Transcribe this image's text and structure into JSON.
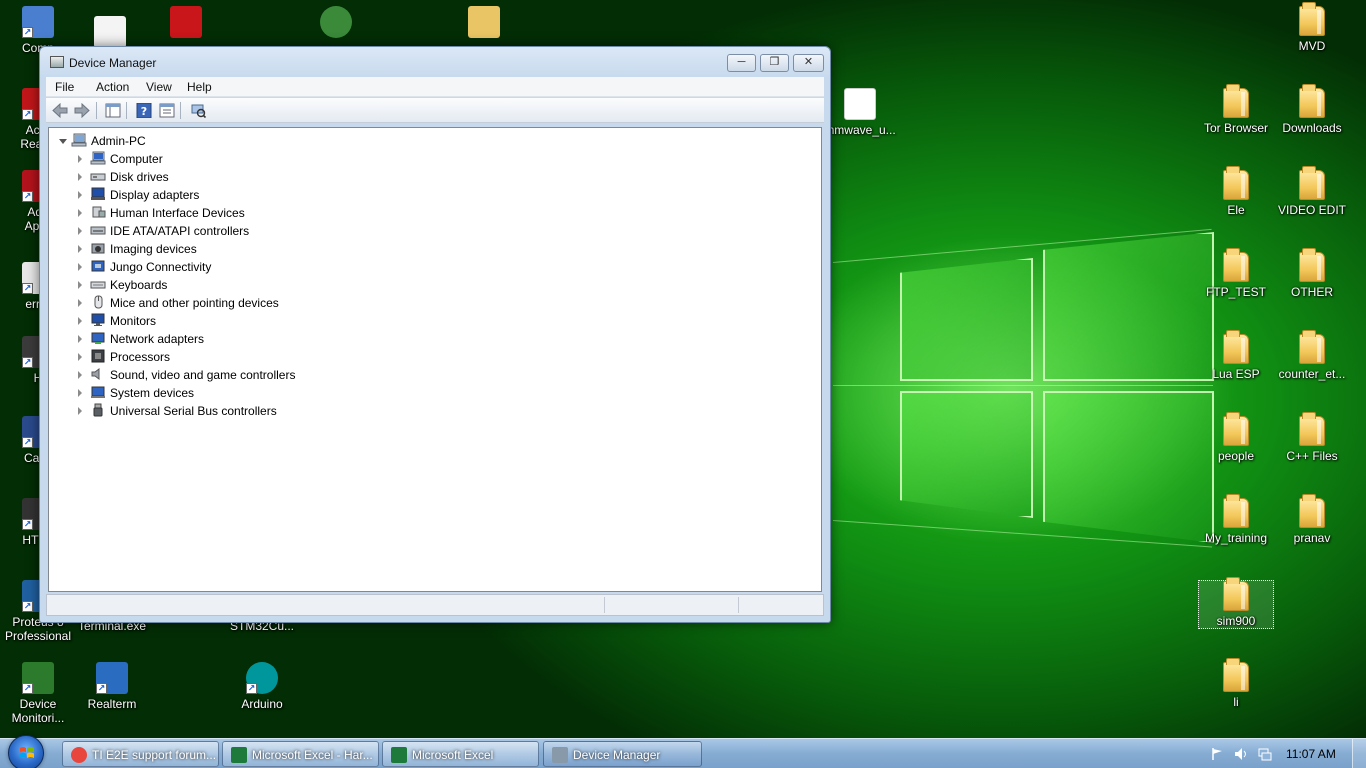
{
  "colors": {
    "accent_green": "#1fc21a",
    "window_frame": "#c7d9ec",
    "taskbar": "#86acd3"
  },
  "desktop_left": [
    {
      "label": "Comp",
      "icon": "computer-icon"
    },
    {
      "label": "Acro\nReade",
      "icon": "acrobat-icon"
    },
    {
      "label": "Ado\nAppli",
      "icon": "adobe-app-icon"
    },
    {
      "label": "error",
      "icon": "document-icon"
    },
    {
      "label": "H",
      "icon": "app-shortcut-icon"
    },
    {
      "label": "Caml",
      "icon": "camera-app-icon"
    },
    {
      "label": "HTTP",
      "icon": "http-app-icon"
    },
    {
      "label": "Proteus 8\nProfessional",
      "icon": "proteus-icon"
    },
    {
      "label": "Device\nMonitori...",
      "icon": "device-monitor-icon"
    }
  ],
  "desktop_mid": [
    {
      "label": "Terminal.exe",
      "icon": "terminal-icon"
    },
    {
      "label": "STM32Cu...",
      "icon": "stm32-icon"
    },
    {
      "label": "Realterm",
      "icon": "realterm-icon"
    },
    {
      "label": "Arduino",
      "icon": "arduino-icon"
    },
    {
      "label": "mmwave_u...",
      "icon": "document-icon"
    }
  ],
  "desktop_right": [
    {
      "label": "MVD"
    },
    {
      "label": "Tor Browser"
    },
    {
      "label": "Downloads"
    },
    {
      "label": "Ele"
    },
    {
      "label": "VIDEO EDIT"
    },
    {
      "label": "FTP_TEST"
    },
    {
      "label": "OTHER"
    },
    {
      "label": "Lua ESP"
    },
    {
      "label": "counter_et..."
    },
    {
      "label": "people"
    },
    {
      "label": "C++ Files"
    },
    {
      "label": "My_training"
    },
    {
      "label": "pranav"
    },
    {
      "label": "sim900"
    },
    {
      "label": "li"
    }
  ],
  "window": {
    "title": "Device Manager",
    "menu": [
      "File",
      "Action",
      "View",
      "Help"
    ],
    "toolbar": [
      "back-icon",
      "forward-icon",
      "show-hide-tree-icon",
      "help-icon",
      "properties-icon",
      "scan-hardware-icon"
    ]
  },
  "tree": {
    "root": "Admin-PC",
    "items": [
      {
        "label": "Computer",
        "icon": "computer-icon"
      },
      {
        "label": "Disk drives",
        "icon": "disk-drive-icon"
      },
      {
        "label": "Display adapters",
        "icon": "display-adapter-icon"
      },
      {
        "label": "Human Interface Devices",
        "icon": "hid-icon"
      },
      {
        "label": "IDE ATA/ATAPI controllers",
        "icon": "ide-controller-icon"
      },
      {
        "label": "Imaging devices",
        "icon": "imaging-device-icon"
      },
      {
        "label": "Jungo Connectivity",
        "icon": "jungo-icon"
      },
      {
        "label": "Keyboards",
        "icon": "keyboard-icon"
      },
      {
        "label": "Mice and other pointing devices",
        "icon": "mouse-icon"
      },
      {
        "label": "Monitors",
        "icon": "monitor-icon"
      },
      {
        "label": "Network adapters",
        "icon": "network-adapter-icon"
      },
      {
        "label": "Processors",
        "icon": "processor-icon"
      },
      {
        "label": "Sound, video and game controllers",
        "icon": "sound-icon"
      },
      {
        "label": "System devices",
        "icon": "system-device-icon"
      },
      {
        "label": "Universal Serial Bus controllers",
        "icon": "usb-icon"
      }
    ]
  },
  "taskbar": {
    "tasks": [
      {
        "label": "TI E2E support forum...",
        "icon": "chrome-icon",
        "color": "#e8453c"
      },
      {
        "label": "Microsoft Excel - Har...",
        "icon": "excel-icon",
        "color": "#1d7a3a"
      },
      {
        "label": "Microsoft Excel",
        "icon": "excel-icon",
        "color": "#1d7a3a"
      },
      {
        "label": "Device Manager",
        "icon": "device-manager-icon",
        "color": "#8899aa"
      }
    ],
    "clock": "11:07 AM"
  }
}
